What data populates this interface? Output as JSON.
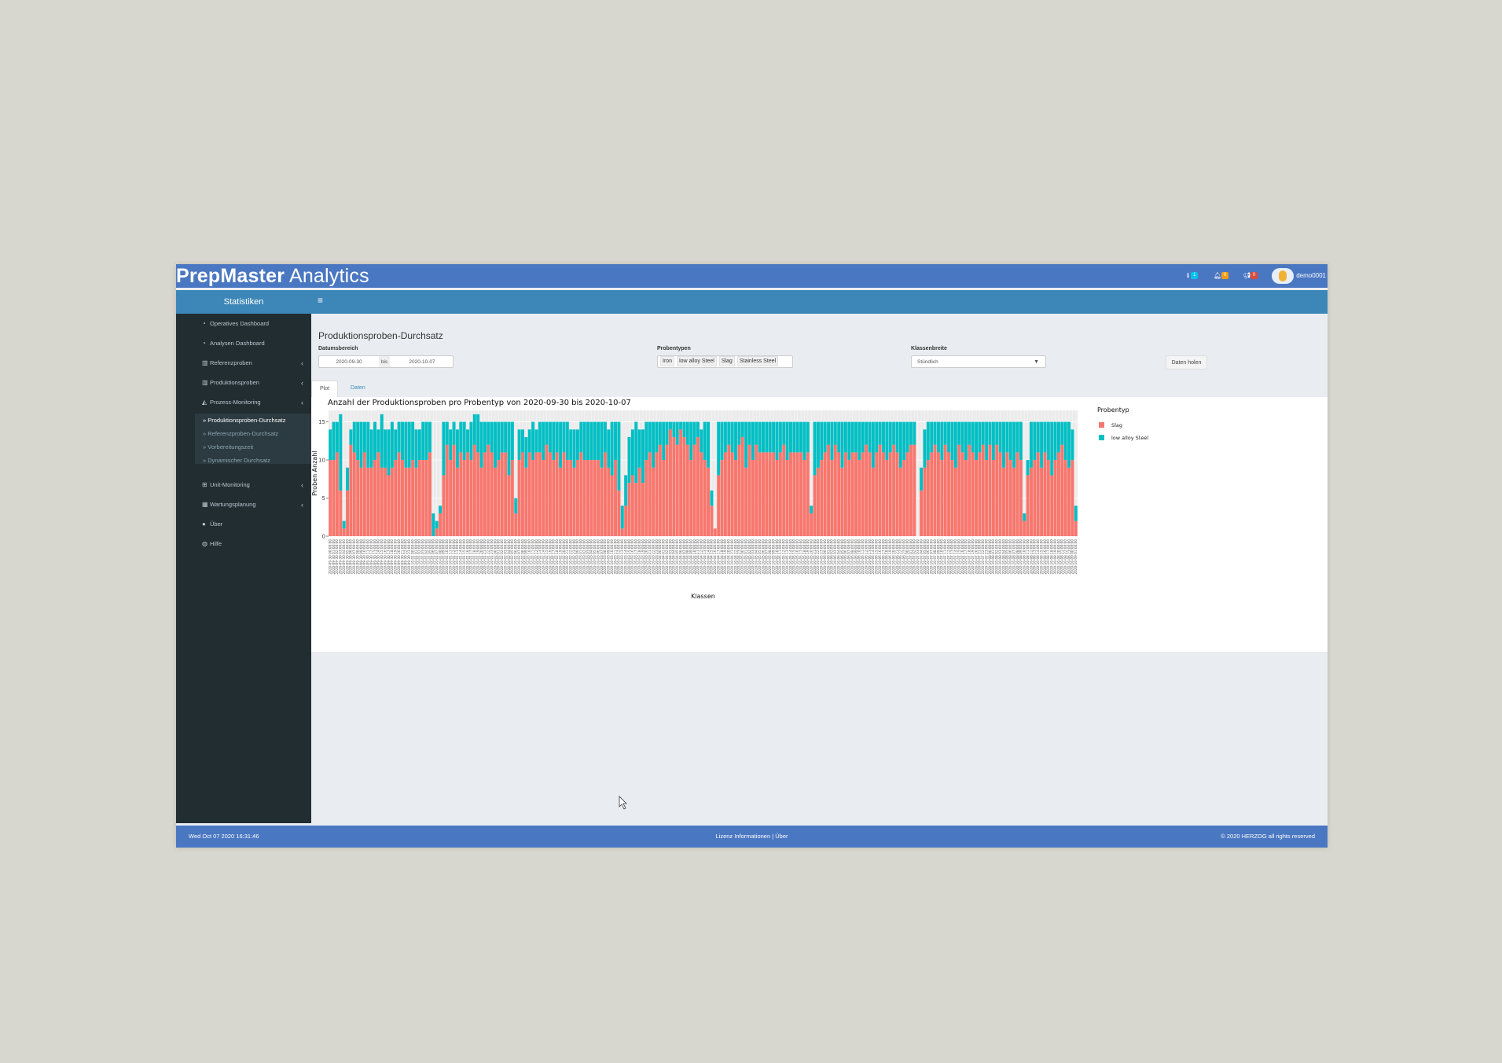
{
  "header": {
    "brand_bold": "PrepMaster",
    "brand_light": " Analytics",
    "info_count": "1",
    "bell_count": "0",
    "announce_count": "0",
    "username": "demo0001"
  },
  "sidebar": {
    "title": "Statistiken",
    "items": [
      {
        "label": "Operatives Dashboard",
        "icon": "dashboard-icon"
      },
      {
        "label": "Analysen Dashboard",
        "icon": "dashboard-icon"
      },
      {
        "label": "Referenzproben",
        "icon": "bar-chart-icon"
      },
      {
        "label": "Produktionsproben",
        "icon": "bar-chart-icon"
      },
      {
        "label": "Prozess-Monitoring",
        "icon": "area-chart-icon"
      },
      {
        "label": "Unit-Monitoring",
        "icon": "sitemap-icon"
      },
      {
        "label": "Wartungsplanung",
        "icon": "calendar-icon"
      },
      {
        "label": "Über",
        "icon": "info-icon"
      },
      {
        "label": "Hilfe",
        "icon": "globe-icon"
      }
    ],
    "subitems": [
      {
        "label": "Produktionsproben-Durchsatz"
      },
      {
        "label": "Referenzproben-Durchsatz"
      },
      {
        "label": "Vorbereitungszeit"
      },
      {
        "label": "Dynamischer Durchsatz"
      }
    ]
  },
  "page": {
    "title": "Produktionsproben-Durchsatz",
    "date_label": "Datumsbereich",
    "date_from": "2020-09-30",
    "date_sep": "bis",
    "date_to": "2020-10-07",
    "types_label": "Probentypen",
    "types": [
      "Iron",
      "low alloy Steel",
      "Slag",
      "Stainless Steel"
    ],
    "class_label": "Klassenbreite",
    "class_value": "Stündlich",
    "fetch_button": "Daten holen",
    "tabs": [
      "Plot",
      "Daten"
    ]
  },
  "chart_data": {
    "type": "bar",
    "stacked": true,
    "title": "Anzahl der Produktionsproben pro Probentyp von 2020-09-30 bis 2020-10-07",
    "xlabel": "Klassen",
    "ylabel": "Proben Anzahl",
    "ylim": [
      0,
      16.5
    ],
    "yticks": [
      0,
      5,
      10,
      15
    ],
    "legend_title": "Probentyp",
    "legend_position": "right",
    "grid": true,
    "series": [
      {
        "name": "Slag",
        "color": "#f8766d",
        "values": [
          10,
          10,
          11,
          6,
          1,
          6,
          12,
          11,
          10,
          9,
          11,
          9,
          9,
          10,
          11,
          9,
          9,
          8,
          9,
          10,
          11,
          10,
          9,
          9,
          10,
          9,
          10,
          10,
          10,
          11,
          0,
          1,
          3,
          8,
          12,
          10,
          12,
          9,
          11,
          10,
          11,
          10,
          12,
          11,
          9,
          11,
          12,
          11,
          9,
          10,
          11,
          11,
          8,
          10,
          3,
          10,
          11,
          9,
          11,
          10,
          11,
          11,
          10,
          12,
          11,
          10,
          11,
          9,
          11,
          10,
          10,
          9,
          10,
          11,
          10,
          10,
          10,
          10,
          10,
          9,
          11,
          9,
          8,
          10,
          6,
          1,
          4,
          7,
          8,
          7,
          9,
          7,
          10,
          11,
          9,
          11,
          12,
          10,
          12,
          14,
          13,
          12,
          14,
          13,
          12,
          10,
          12,
          13,
          11,
          10,
          9,
          4,
          1,
          8,
          10,
          11,
          12,
          11,
          10,
          12,
          13,
          9,
          12,
          10,
          12,
          11,
          11,
          11,
          11,
          11,
          10,
          11,
          12,
          10,
          11,
          11,
          11,
          11,
          10,
          11,
          3,
          8,
          9,
          10,
          11,
          12,
          10,
          12,
          11,
          9,
          11,
          10,
          11,
          11,
          10,
          11,
          12,
          11,
          9,
          11,
          12,
          11,
          10,
          11,
          12,
          11,
          9,
          10,
          11,
          12,
          12,
          0,
          6,
          9,
          10,
          11,
          12,
          11,
          10,
          12,
          11,
          10,
          9,
          12,
          11,
          10,
          12,
          11,
          10,
          11,
          12,
          10,
          12,
          10,
          12,
          11,
          9,
          11,
          10,
          9,
          11,
          10,
          2,
          8,
          9,
          10,
          11,
          9,
          11,
          10,
          8,
          10,
          11,
          12,
          10,
          9,
          10,
          2
        ]
      },
      {
        "name": "low alloy Steel",
        "color": "#00bfc4",
        "values": [
          4,
          5,
          4,
          10,
          1,
          3,
          2,
          4,
          5,
          6,
          4,
          6,
          5,
          5,
          3,
          7,
          5,
          6,
          6,
          4,
          4,
          5,
          6,
          6,
          5,
          5,
          4,
          5,
          5,
          4,
          3,
          1,
          1,
          7,
          3,
          4,
          3,
          5,
          4,
          5,
          3,
          5,
          4,
          5,
          6,
          4,
          3,
          4,
          6,
          5,
          4,
          4,
          7,
          5,
          2,
          4,
          3,
          4,
          3,
          5,
          3,
          4,
          5,
          3,
          4,
          5,
          4,
          6,
          4,
          5,
          4,
          5,
          4,
          4,
          5,
          5,
          5,
          5,
          5,
          6,
          4,
          5,
          7,
          5,
          9,
          3,
          4,
          6,
          6,
          8,
          5,
          7,
          5,
          4,
          6,
          4,
          3,
          5,
          3,
          1,
          2,
          3,
          1,
          2,
          3,
          5,
          3,
          2,
          3,
          5,
          6,
          2,
          0,
          7,
          5,
          4,
          3,
          4,
          5,
          3,
          2,
          6,
          3,
          5,
          3,
          4,
          4,
          4,
          4,
          4,
          5,
          4,
          3,
          5,
          4,
          4,
          4,
          4,
          5,
          4,
          1,
          7,
          6,
          5,
          4,
          3,
          5,
          3,
          4,
          6,
          4,
          5,
          4,
          4,
          5,
          4,
          3,
          4,
          6,
          4,
          3,
          4,
          5,
          4,
          3,
          4,
          6,
          5,
          4,
          3,
          3,
          0,
          3,
          5,
          5,
          4,
          3,
          4,
          5,
          3,
          4,
          5,
          6,
          3,
          4,
          5,
          3,
          4,
          5,
          4,
          3,
          5,
          3,
          5,
          3,
          4,
          6,
          4,
          5,
          6,
          4,
          5,
          1,
          2,
          6,
          5,
          4,
          6,
          4,
          5,
          7,
          5,
          4,
          3,
          5,
          6,
          4,
          2
        ]
      }
    ],
    "x_start": "2020-09-30 00:00",
    "x_step": "1 hour"
  },
  "footer": {
    "datetime": "Wed Oct 07 2020 16:31:46",
    "links": "Lizenz Informationen  |  Über",
    "copyright": "© 2020 HERZOG all rights reserved"
  }
}
